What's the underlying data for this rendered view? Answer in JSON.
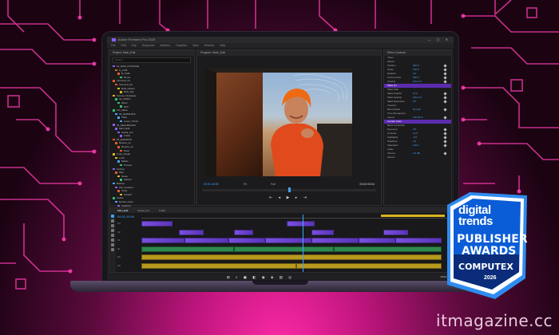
{
  "window": {
    "title": "Adobe Premiere Pro 2025",
    "controls": "—  ▢  ✕"
  },
  "menu": [
    "File",
    "Edit",
    "Clip",
    "Sequence",
    "Markers",
    "Graphics",
    "View",
    "Window",
    "Help"
  ],
  "project_panel": {
    "title": "Project: Main_Edit",
    "search_placeholder": "Search",
    "items": [
      {
        "label": "01_RAW_FOOTAGE",
        "color": "#8a5cf5"
      },
      {
        "label": "A_CAM",
        "color": "#e05a2a"
      },
      {
        "label": "B_CAM",
        "color": "#e05a2a"
      },
      {
        "label": "Drone",
        "color": "#2fbf71"
      },
      {
        "label": "Interview_01",
        "color": "#e05a2a"
      },
      {
        "label": "Interview_02",
        "color": "#e05a2a"
      },
      {
        "label": "Broll_Desert",
        "color": "#d9b320"
      },
      {
        "label": "Broll_Van",
        "color": "#d9b320"
      },
      {
        "label": "Sunset_Timelapse",
        "color": "#d9b320"
      },
      {
        "label": "02_AUDIO",
        "color": "#2fbf71"
      },
      {
        "label": "Music",
        "color": "#2fbf71"
      },
      {
        "label": "SFX",
        "color": "#2fbf71"
      },
      {
        "label": "VO_Takes",
        "color": "#2fbf71"
      },
      {
        "label": "03_GRAPHICS",
        "color": "#3fa4ff"
      },
      {
        "label": "Titles",
        "color": "#3fa4ff"
      },
      {
        "label": "Lower_Thirds",
        "color": "#3fa4ff"
      },
      {
        "label": "04_SEQUENCES",
        "color": "#8a5cf5"
      },
      {
        "label": "Main_Edit",
        "color": "#8a5cf5"
      },
      {
        "label": "Social_Cut",
        "color": "#8a5cf5"
      },
      {
        "label": "Trailer",
        "color": "#8a5cf5"
      },
      {
        "label": "05_EXPORTS",
        "color": "#e05a2a"
      },
      {
        "label": "Review_v1",
        "color": "#e05a2a"
      },
      {
        "label": "Review_v2",
        "color": "#e05a2a"
      },
      {
        "label": "Final",
        "color": "#e05a2a"
      },
      {
        "label": "Color_Grade",
        "color": "#d9b320"
      },
      {
        "label": "LUTs",
        "color": "#d9b320"
      },
      {
        "label": "Masks",
        "color": "#3fa4ff"
      },
      {
        "label": "Proxies",
        "color": "#2fbf71"
      },
      {
        "label": "Archive",
        "color": "#8a5cf5"
      },
      {
        "label": "Misc",
        "color": "#e05a2a"
      },
      {
        "label": "Notes",
        "color": "#d9b320"
      },
      {
        "label": "Selects",
        "color": "#2fbf71"
      },
      {
        "label": "Backup",
        "color": "#3fa4ff"
      },
      {
        "label": "Old_Versions",
        "color": "#8a5cf5"
      },
      {
        "label": "Temp",
        "color": "#e05a2a"
      },
      {
        "label": "Scratch",
        "color": "#d9b320"
      },
      {
        "label": "Cache",
        "color": "#2fbf71"
      },
      {
        "label": "Render_Files",
        "color": "#3fa4ff"
      },
      {
        "label": "Captions",
        "color": "#8a5cf5"
      },
      {
        "label": "End_Card",
        "color": "#e05a2a"
      }
    ]
  },
  "program_monitor": {
    "title": "Program: Main_Edit",
    "timecode_left": "00:01:15:09",
    "fit": "Fit",
    "resolution": "Full",
    "timecode_right": "00:02:03:04",
    "transport": "⇤ ◂ ▶ ▸ ⇥"
  },
  "effect_controls": {
    "title": "Effect Controls",
    "rows": [
      {
        "label": "Video",
        "value": "",
        "hl": false
      },
      {
        "label": "Motion",
        "value": "",
        "hl": false
      },
      {
        "label": "Position",
        "value": "960.0",
        "hl": false
      },
      {
        "label": "Scale",
        "value": "100.0",
        "hl": false
      },
      {
        "label": "Rotation",
        "value": "0.0",
        "hl": false
      },
      {
        "label": "Anchor Point",
        "value": "960.0",
        "hl": false
      },
      {
        "label": "Opacity",
        "value": "100.0 %",
        "hl": false
      },
      {
        "label": "Mask (1)",
        "value": "",
        "hl": true
      },
      {
        "label": "Mask Path",
        "value": "",
        "hl": false
      },
      {
        "label": "Mask Feather",
        "value": "10.0",
        "hl": false
      },
      {
        "label": "Mask Opacity",
        "value": "100.0 %",
        "hl": false
      },
      {
        "label": "Mask Expansion",
        "value": "0.0",
        "hl": false
      },
      {
        "label": "Inverted",
        "value": "",
        "hl": false
      },
      {
        "label": "Blend Mode",
        "value": "Normal",
        "hl": false
      },
      {
        "label": "Time Remapping",
        "value": "",
        "hl": false
      },
      {
        "label": "Speed",
        "value": "100.00 %",
        "hl": false
      },
      {
        "label": "Lumetri Color",
        "value": "",
        "hl": true
      },
      {
        "label": "Basic Correction",
        "value": "",
        "hl": false
      },
      {
        "label": "Exposure",
        "value": "0.5",
        "hl": false
      },
      {
        "label": "Contrast",
        "value": "12.0",
        "hl": false
      },
      {
        "label": "Highlights",
        "value": "-8.0",
        "hl": false
      },
      {
        "label": "Shadows",
        "value": "4.0",
        "hl": false
      },
      {
        "label": "Saturation",
        "value": "110.0",
        "hl": false
      },
      {
        "label": "Audio",
        "value": "",
        "hl": false
      },
      {
        "label": "Volume",
        "value": "0.0 dB",
        "hl": false
      },
      {
        "label": "Panner",
        "value": "",
        "hl": false
      }
    ]
  },
  "timeline": {
    "tabs": [
      "Main_Edit",
      "Social_Cut",
      "Trailer"
    ],
    "timecode": "00:01:15:09",
    "tools": [
      "selection",
      "track-select",
      "ripple",
      "razor",
      "slip",
      "pen",
      "hand",
      "type"
    ],
    "tracks": [
      {
        "label": "V3",
        "type": "v",
        "clips": [
          [
            0.0,
            0.1
          ],
          [
            0.47,
            0.56
          ]
        ]
      },
      {
        "label": "V2",
        "type": "v",
        "clips": [
          [
            0.12,
            0.2
          ],
          [
            0.3,
            0.36
          ],
          [
            0.55,
            0.62
          ],
          [
            0.78,
            0.86
          ]
        ]
      },
      {
        "label": "V1",
        "type": "v",
        "clips": [
          [
            0.0,
            0.14
          ],
          [
            0.14,
            0.28
          ],
          [
            0.28,
            0.4
          ],
          [
            0.4,
            0.55
          ],
          [
            0.55,
            0.7
          ],
          [
            0.7,
            0.82
          ],
          [
            0.82,
            0.97
          ]
        ]
      },
      {
        "label": "A1",
        "type": "a",
        "clips": [
          [
            0.0,
            0.3
          ],
          [
            0.3,
            0.62
          ],
          [
            0.62,
            0.97
          ]
        ]
      },
      {
        "label": "A2",
        "type": "y",
        "clips": [
          [
            0.0,
            0.97
          ]
        ]
      },
      {
        "label": "A3",
        "type": "y",
        "clips": [
          [
            0.0,
            0.5
          ],
          [
            0.5,
            0.97
          ]
        ]
      }
    ]
  },
  "taskbar": {
    "icons": "⊞ ⌕ ▣ ◧ ◉ ◈ ▤ ◎",
    "clock": "10:24 AM"
  },
  "badge": {
    "line1": "digital",
    "line2": "trends",
    "line3": "PUBLISHER",
    "line4": "AWARDS",
    "line5": "COMPUTEX",
    "year": "2026",
    "colors": {
      "blue": "#0b5dd7",
      "light_blue": "#2f8cf0",
      "navy": "#0a2c7a"
    }
  },
  "watermark": "itmagazine.cc",
  "colors": {
    "accent": "#ff2aa8",
    "premiere_purple": "#8a5cf5",
    "ui_blue": "#3fa4ff"
  }
}
